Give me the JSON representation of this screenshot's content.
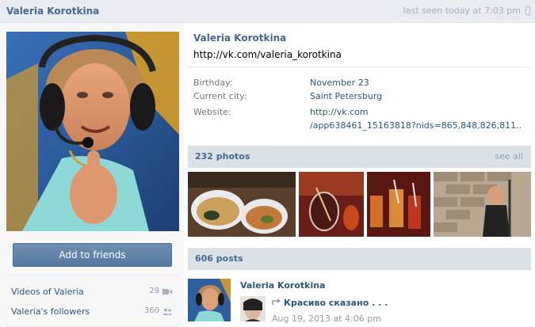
{
  "topbar": {
    "name": "Valeria Korotkina",
    "last_seen": "last seen today at 7:03 pm"
  },
  "sidebar": {
    "add_friend": "Add to friends",
    "links": [
      {
        "label": "Videos of Valeria",
        "count": "29"
      },
      {
        "label": "Valeria's followers",
        "count": "360"
      }
    ]
  },
  "profile": {
    "name": "Valeria Korotkina",
    "status": "http://vk.com/valeria_korotkina",
    "info": [
      {
        "label": "Birthday:",
        "value": "November 23"
      },
      {
        "label": "Current city:",
        "value": "Saint Petersburg"
      },
      {
        "label": "Website:",
        "value": "http://vk.com",
        "value2": "/app638461_15163818?nids=865,848,826,811.."
      }
    ]
  },
  "photos": {
    "title": "232 photos",
    "see_all": "see all"
  },
  "posts": {
    "title": "606 posts",
    "author": "Valeria Korotkina",
    "repost_title": "Красиво сказано . . .",
    "date": "Aug 19, 2013 at 4:06 pm"
  },
  "colors": {
    "link": "#2b587a",
    "header": "#45688e",
    "section_bg": "#dae2e8",
    "button": "#5f82a8"
  }
}
